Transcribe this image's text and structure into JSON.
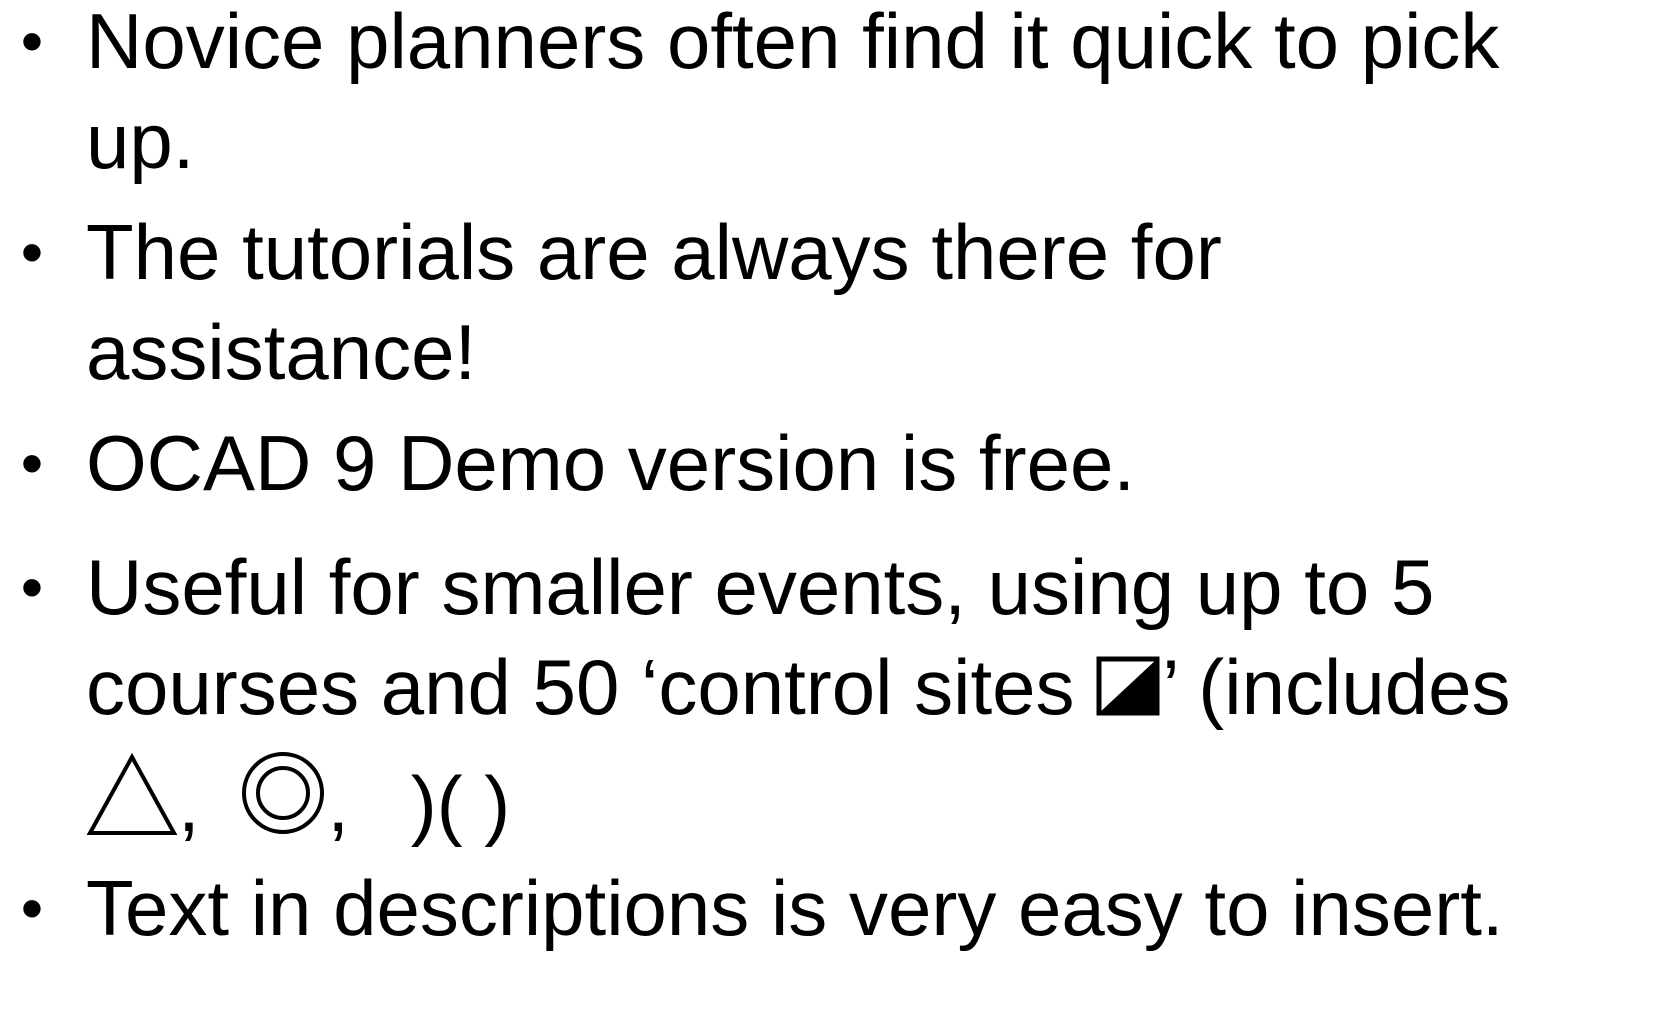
{
  "slide": {
    "bullets": [
      {
        "lines": [
          "Novice planners often find it quick to pick",
          "up."
        ]
      },
      {
        "lines": [
          "The tutorials are always there for",
          "assistance!"
        ]
      },
      {
        "lines": [
          "OCAD 9 Demo version is free."
        ]
      },
      {
        "line1": "Useful for smaller events, using up to 5",
        "line2_a": "courses and 50 ‘control sites ",
        "line2_b": "’ (includes",
        "line3_sep1": ",",
        "line3_sep2": ",",
        "line3_paren": ")( )",
        "icons": [
          "control-site-icon",
          "triangle-start-icon",
          "double-circle-finish-icon"
        ]
      },
      {
        "lines": [
          "Text in descriptions is very easy to insert."
        ]
      }
    ],
    "bullet_glyph": "•",
    "text_color": "#000000",
    "background_color": "#ffffff"
  }
}
